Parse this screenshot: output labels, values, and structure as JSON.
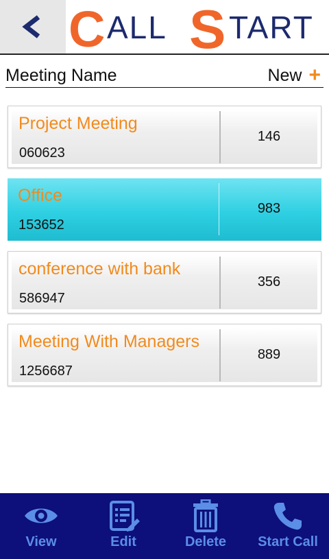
{
  "header": {
    "back_icon": "chevron-left-icon",
    "logo": {
      "text_a": "C",
      "text_b": "ALL",
      "text_c": "S",
      "text_d": "TART"
    },
    "colors": {
      "orange": "#f0662a",
      "navy": "#1c2a6e"
    }
  },
  "title_row": {
    "title": "Meeting Name",
    "new_label": "New",
    "plus": "+"
  },
  "meetings": [
    {
      "name": "Project Meeting",
      "code": "060623",
      "count": "146",
      "selected": false
    },
    {
      "name": "Office",
      "code": "153652",
      "count": "983",
      "selected": true
    },
    {
      "name": "conference with bank",
      "code": "586947",
      "count": "356",
      "selected": false
    },
    {
      "name": "Meeting With Managers",
      "code": "1256687",
      "count": "889",
      "selected": false
    }
  ],
  "toolbar": {
    "view_label": "View",
    "edit_label": "Edit",
    "delete_label": "Delete",
    "start_call_label": "Start Call"
  },
  "colors": {
    "accent": "#f28a1c",
    "toolbar_bg": "#0d0f7a",
    "toolbar_text": "#5b8ee6",
    "selected_bg": "#2ed0e2"
  }
}
